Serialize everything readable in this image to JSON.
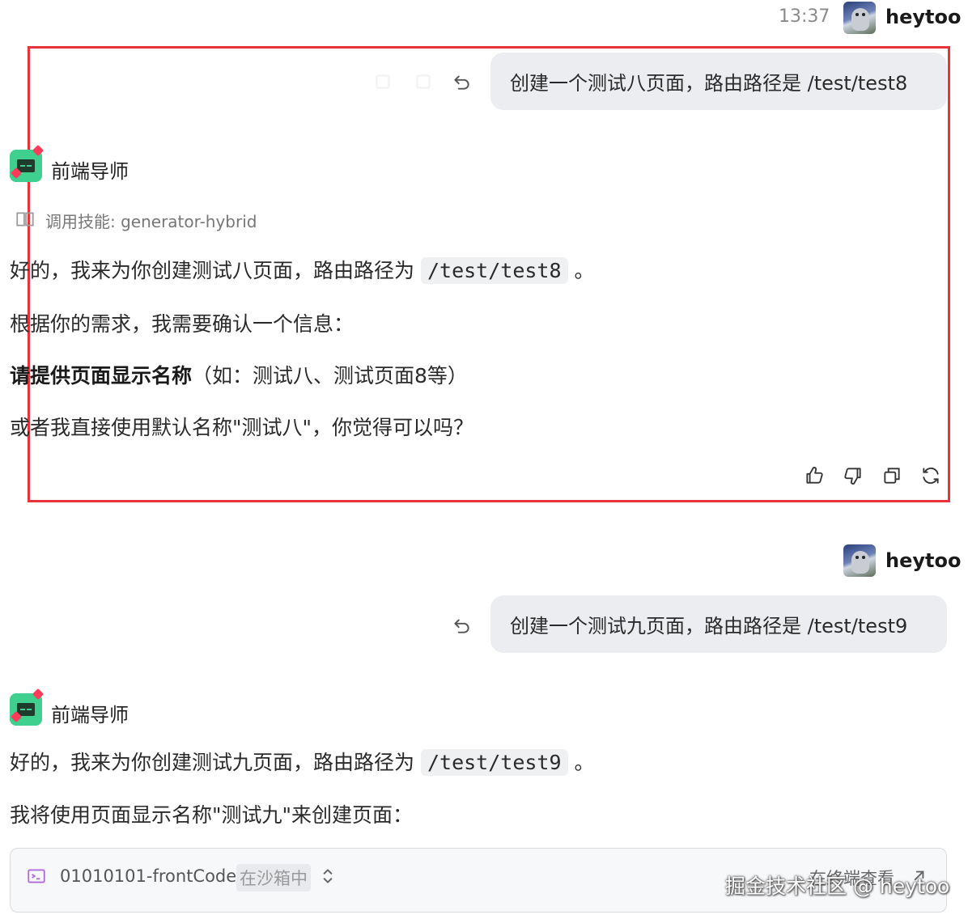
{
  "messages": [
    {
      "time": "13:37",
      "user": "heytoo",
      "text": "创建一个测试八页面，路由路径是 /test/test8"
    },
    {
      "user": "heytoo",
      "text": "创建一个测试九页面，路由路径是 /test/test9"
    }
  ],
  "bot": {
    "name": "前端导师"
  },
  "reply1": {
    "skill_label": "调用技能: generator-hybrid",
    "line1_pre": "好的，我来为你创建测试八页面，路由路径为",
    "line1_code": "/test/test8",
    "line1_post": "。",
    "line2": "根据你的需求，我需要确认一个信息：",
    "line3_bold": "请提供页面显示名称",
    "line3_rest": "（如：测试八、测试页面8等）",
    "line4": "或者我直接使用默认名称\"测试八\"，你觉得可以吗？"
  },
  "reply2": {
    "line1_pre": "好的，我来为你创建测试九页面，路由路径为",
    "line1_code": "/test/test9",
    "line1_post": "。",
    "line2": "我将使用页面显示名称\"测试九\"来创建页面：",
    "tool_name": "01010101-frontCode",
    "tool_status": "在沙箱中",
    "terminal_link": "在终端查看",
    "watermark": "掘金技术社区 @ heytoo"
  },
  "colors": {
    "accent_green": "#3fcf8e",
    "highlight_border": "#e8323c",
    "bubble_bg": "#ebedf0"
  },
  "icons": [
    "undo-icon",
    "copy-icon",
    "thumbs-up-icon",
    "thumbs-down-icon",
    "refresh-icon",
    "terminal-icon",
    "chevron-updown-icon",
    "external-link-icon",
    "book-icon"
  ]
}
